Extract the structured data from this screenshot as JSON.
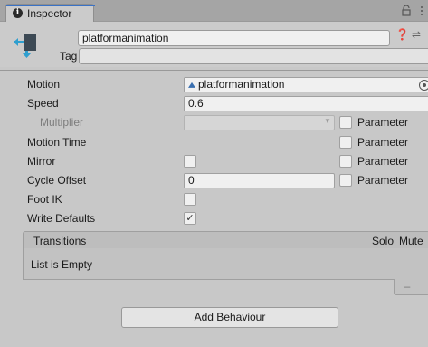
{
  "tab": {
    "label": "Inspector"
  },
  "header": {
    "name": "platformanimation",
    "tag_label": "Tag",
    "tag_value": ""
  },
  "fields": {
    "motion": {
      "label": "Motion",
      "value": "platformanimation"
    },
    "speed": {
      "label": "Speed",
      "value": "0.6"
    },
    "multiplier": {
      "label": "Multiplier",
      "value": "",
      "param_label": "Parameter"
    },
    "motion_time": {
      "label": "Motion Time",
      "param_label": "Parameter"
    },
    "mirror": {
      "label": "Mirror",
      "checked": false,
      "param_label": "Parameter"
    },
    "cycle_offset": {
      "label": "Cycle Offset",
      "value": "0",
      "param_label": "Parameter"
    },
    "foot_ik": {
      "label": "Foot IK",
      "checked": false
    },
    "write_defaults": {
      "label": "Write Defaults",
      "checked": true,
      "check_glyph": "✓"
    }
  },
  "transitions": {
    "title": "Transitions",
    "solo": "Solo",
    "mute": "Mute",
    "empty_text": "List is Empty",
    "minus": "–"
  },
  "add_behaviour": {
    "label": "Add Behaviour"
  },
  "colors": {
    "tab_accent": "#3a72c6",
    "background": "#c8c8c8",
    "motion_icon": "#3a6fb0"
  }
}
